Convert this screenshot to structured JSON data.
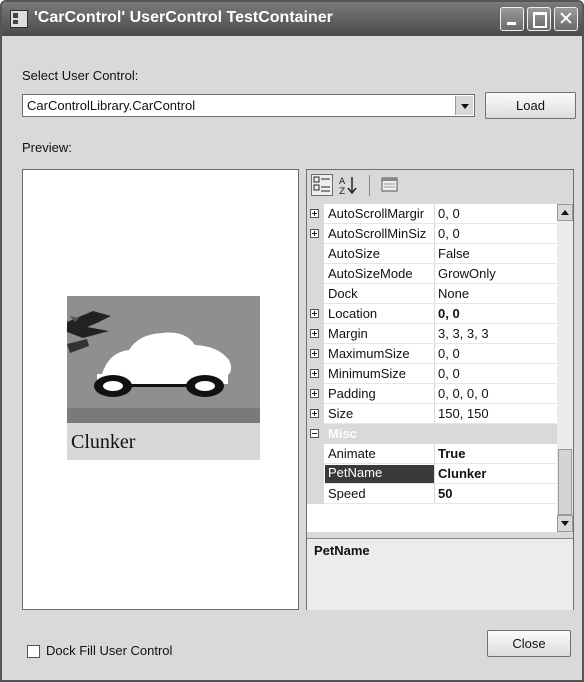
{
  "window": {
    "title": "'CarControl' UserControl TestContainer"
  },
  "select_label": "Select User Control:",
  "combo": {
    "value": "CarControlLibrary.CarControl"
  },
  "load_button": "Load",
  "preview_label": "Preview:",
  "car_name": "Clunker",
  "property_grid": {
    "rows": [
      {
        "name": "AutoScrollMargir",
        "value": "0, 0",
        "expandable": true
      },
      {
        "name": "AutoScrollMinSiz",
        "value": "0, 0",
        "expandable": true
      },
      {
        "name": "AutoSize",
        "value": "False",
        "expandable": false
      },
      {
        "name": "AutoSizeMode",
        "value": "GrowOnly",
        "expandable": false
      },
      {
        "name": "Dock",
        "value": "None",
        "expandable": false
      },
      {
        "name": "Location",
        "value": "0, 0",
        "expandable": true,
        "bold": true
      },
      {
        "name": "Margin",
        "value": "3, 3, 3, 3",
        "expandable": true
      },
      {
        "name": "MaximumSize",
        "value": "0, 0",
        "expandable": true
      },
      {
        "name": "MinimumSize",
        "value": "0, 0",
        "expandable": true
      },
      {
        "name": "Padding",
        "value": "0, 0, 0, 0",
        "expandable": true
      },
      {
        "name": "Size",
        "value": "150, 150",
        "expandable": true
      }
    ],
    "category": "Misc",
    "misc_rows": [
      {
        "name": "Animate",
        "value": "True",
        "bold": true
      },
      {
        "name": "PetName",
        "value": "Clunker",
        "bold": true,
        "selected": true
      },
      {
        "name": "Speed",
        "value": "50",
        "bold": true
      }
    ],
    "description_title": "PetName"
  },
  "dock_fill_label": "Dock Fill User Control",
  "dock_fill_checked": false,
  "close_button": "Close"
}
